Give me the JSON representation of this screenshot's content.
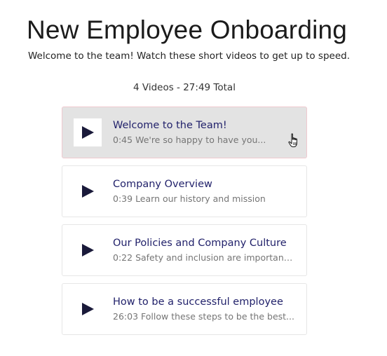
{
  "header": {
    "title": "New Employee Onboarding",
    "subtitle": "Welcome to the team! Watch these short videos to get up to speed."
  },
  "summary": "4 Videos - 27:49 Total",
  "videos": [
    {
      "title": "Welcome to the Team!",
      "duration": "0:45",
      "description": "We're so happy to have you...",
      "active": true
    },
    {
      "title": "Company Overview",
      "duration": "0:39",
      "description": "Learn our history and mission",
      "active": false
    },
    {
      "title": "Our Policies and Company Culture",
      "duration": "0:22",
      "description": "Safety and inclusion are important...",
      "active": false
    },
    {
      "title": "How to be a successful employee",
      "duration": "26:03",
      "description": "Follow these steps to be the best...",
      "active": false
    }
  ],
  "icons": {
    "play": "play-icon",
    "cursor": "hand-pointer-icon"
  },
  "colors": {
    "title_text": "#22226b",
    "active_bg": "#e3e3e3",
    "play_icon": "#1a1a3a"
  }
}
